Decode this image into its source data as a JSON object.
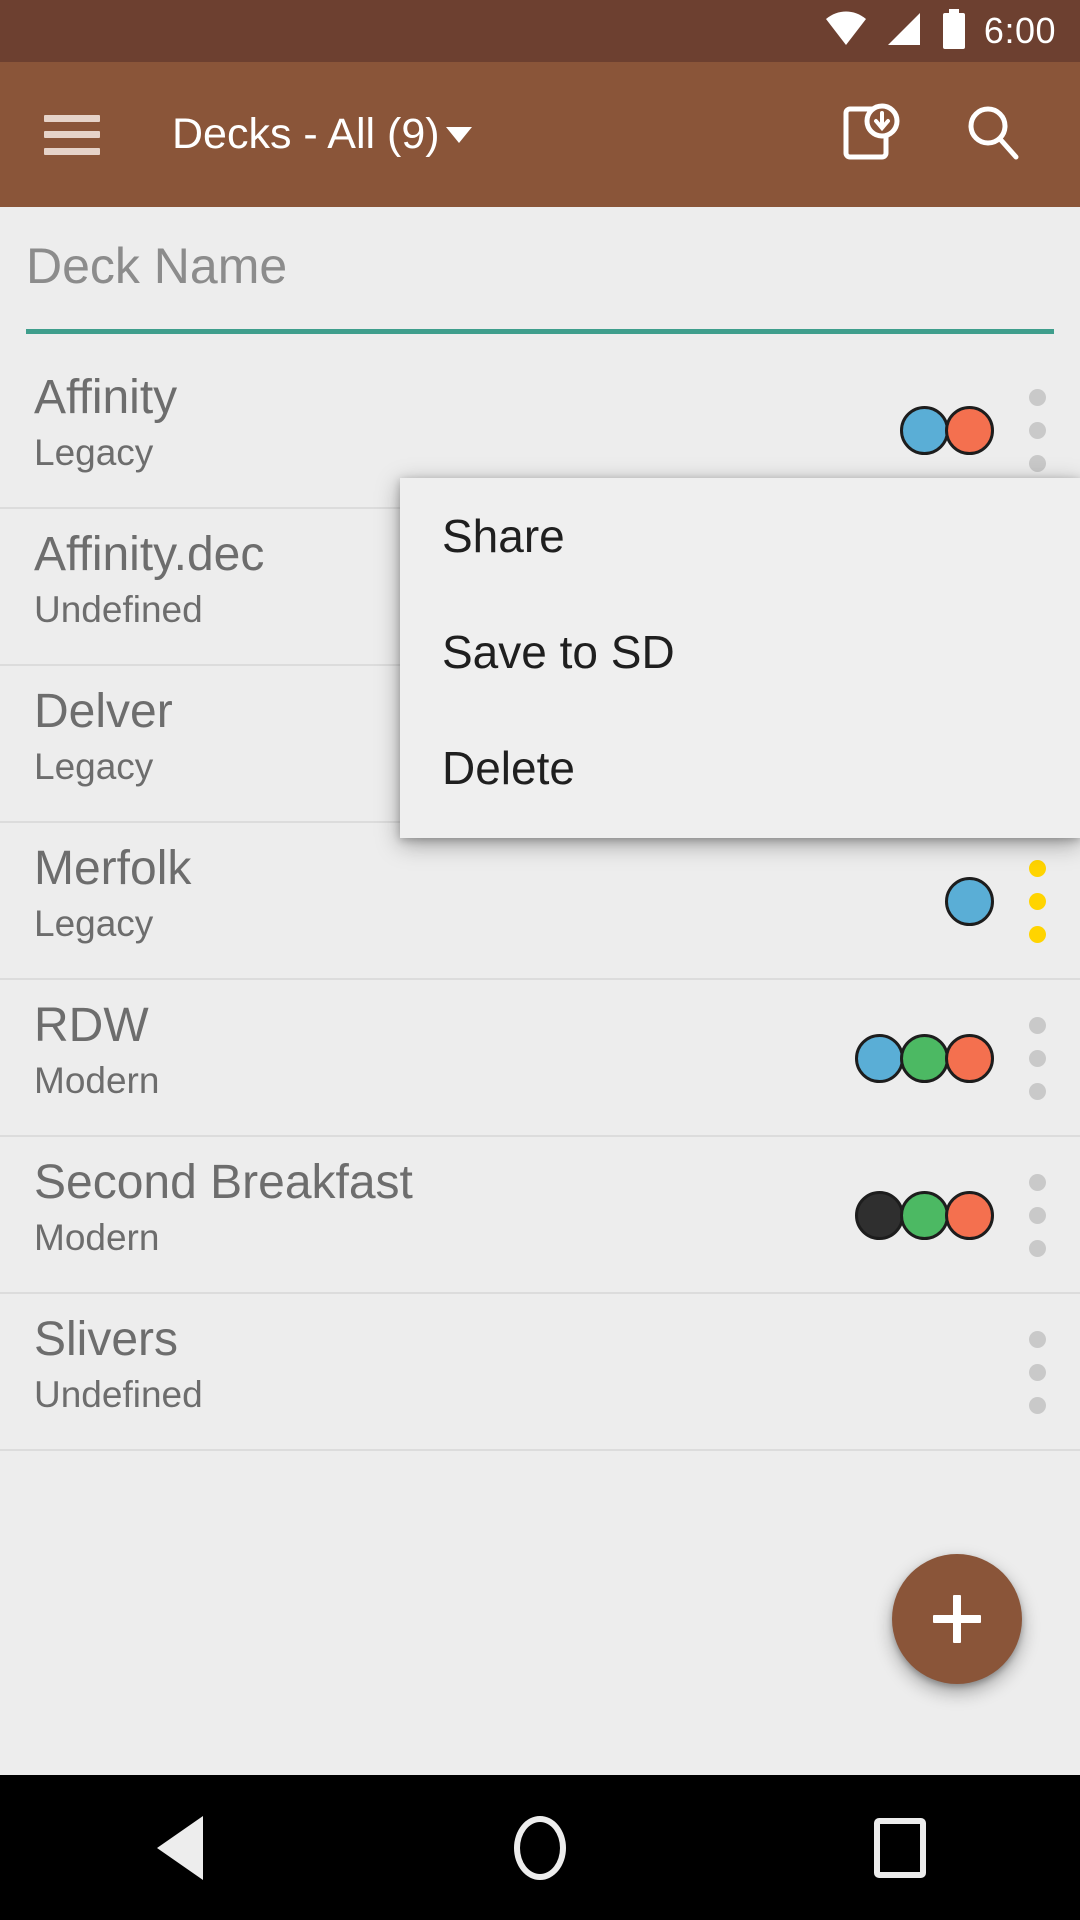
{
  "status_bar": {
    "time": "6:00",
    "icons": [
      "wifi-icon",
      "cellular-signal-icon",
      "battery-icon"
    ]
  },
  "app_bar": {
    "menu_icon": "hamburger-menu-icon",
    "title": "Decks - All (9)",
    "dropdown_caret": "caret-down-icon",
    "actions": [
      {
        "name": "import-deck-icon",
        "label": "Import"
      },
      {
        "name": "search-icon",
        "label": "Search"
      }
    ],
    "background_color": "#8a5539"
  },
  "deck_name_header": {
    "placeholder": "Deck Name",
    "underline_color": "#3f9e8c"
  },
  "decks": [
    {
      "name": "Affinity",
      "format": "Legacy",
      "mana_colors": [
        "#5aaed6",
        "#f4704f"
      ],
      "menu_highlighted": false
    },
    {
      "name": "Affinity.dec",
      "format": "Undefined",
      "mana_colors": [],
      "menu_highlighted": false
    },
    {
      "name": "Delver",
      "format": "Legacy",
      "mana_colors": [],
      "menu_highlighted": false
    },
    {
      "name": "Merfolk",
      "format": "Legacy",
      "mana_colors": [
        "#5aaed6"
      ],
      "menu_highlighted": true
    },
    {
      "name": "RDW",
      "format": "Modern",
      "mana_colors": [
        "#5aaed6",
        "#4cb963",
        "#f4704f"
      ],
      "menu_highlighted": false
    },
    {
      "name": "Second Breakfast",
      "format": "Modern",
      "mana_colors": [
        "#2f2f2f",
        "#4cb963",
        "#f4704f"
      ],
      "menu_highlighted": false
    },
    {
      "name": "Slivers",
      "format": "Undefined",
      "mana_colors": [],
      "menu_highlighted": false
    }
  ],
  "context_menu": {
    "items": [
      {
        "label": "Share"
      },
      {
        "label": "Save to SD"
      },
      {
        "label": "Delete"
      }
    ]
  },
  "fab": {
    "icon": "plus-icon",
    "color": "#8a5539"
  },
  "navigation_bar": {
    "buttons": [
      {
        "name": "nav-back-button",
        "label": "Back"
      },
      {
        "name": "nav-home-button",
        "label": "Home"
      },
      {
        "name": "nav-recents-button",
        "label": "Recents"
      }
    ]
  }
}
